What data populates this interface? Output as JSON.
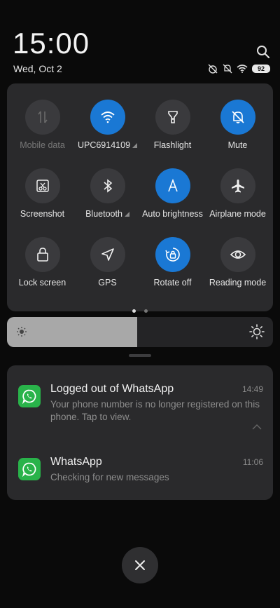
{
  "header": {
    "time": "15:00",
    "date": "Wed, Oct 2",
    "battery": "92"
  },
  "quick_settings": {
    "tiles": [
      {
        "label": "Mobile data",
        "icon": "mobile-data-icon",
        "state": "disabled"
      },
      {
        "label": "UPC6914109",
        "icon": "wifi-icon",
        "state": "active"
      },
      {
        "label": "Flashlight",
        "icon": "flashlight-icon",
        "state": "off"
      },
      {
        "label": "Mute",
        "icon": "bell-off-icon",
        "state": "active"
      },
      {
        "label": "Screenshot",
        "icon": "screenshot-icon",
        "state": "off"
      },
      {
        "label": "Bluetooth",
        "icon": "bluetooth-icon",
        "state": "off"
      },
      {
        "label": "Auto brightness",
        "icon": "auto-brightness-icon",
        "state": "active"
      },
      {
        "label": "Airplane mode",
        "icon": "airplane-icon",
        "state": "off"
      },
      {
        "label": "Lock screen",
        "icon": "lock-icon",
        "state": "off"
      },
      {
        "label": "GPS",
        "icon": "gps-icon",
        "state": "off"
      },
      {
        "label": "Rotate off",
        "icon": "rotate-lock-icon",
        "state": "active"
      },
      {
        "label": "Reading mode",
        "icon": "eye-icon",
        "state": "off"
      }
    ],
    "pages": 2,
    "current_page": 1
  },
  "brightness": {
    "level": 0.49
  },
  "notifications": [
    {
      "app": "WhatsApp",
      "title": "Logged out of WhatsApp",
      "time": "14:49",
      "body": "Your phone number is no longer registered on this phone. Tap to view."
    },
    {
      "app": "WhatsApp",
      "title": "WhatsApp",
      "time": "11:06",
      "body": "Checking for new messages"
    }
  ],
  "colors": {
    "accent": "#1a78d4",
    "whatsapp": "#29b34a",
    "panel": "#2a2a2c"
  }
}
